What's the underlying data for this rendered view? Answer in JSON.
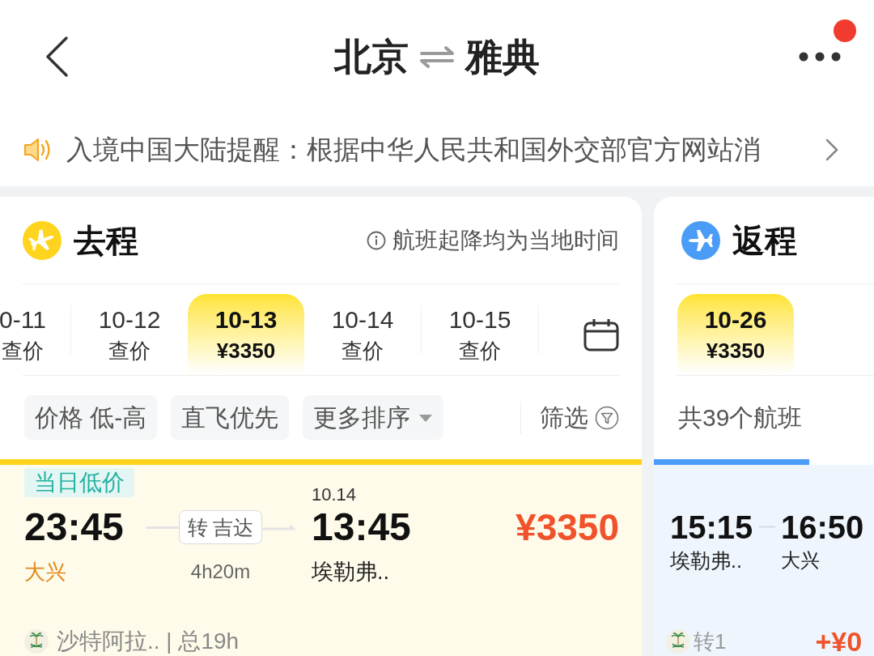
{
  "header": {
    "origin": "北京",
    "destination": "雅典",
    "has_notification": true
  },
  "notice": {
    "text": "入境中国大陆提醒：根据中华人民共和国外交部官方网站消"
  },
  "legs": [
    {
      "kind": "outbound",
      "color": "#ffd41e",
      "title": "去程",
      "note": "航班起降均为当地时间",
      "dates": [
        {
          "date": "0-11",
          "price": "查价",
          "selected": false
        },
        {
          "date": "10-12",
          "price": "查价",
          "selected": false
        },
        {
          "date": "10-13",
          "price": "¥3350",
          "selected": true
        },
        {
          "date": "10-14",
          "price": "查价",
          "selected": false
        },
        {
          "date": "10-15",
          "price": "查价",
          "selected": false
        }
      ],
      "sort_options": [
        {
          "label": "价格 低-高",
          "kind": "chip"
        },
        {
          "label": "直飞优先",
          "kind": "chip"
        },
        {
          "label": "更多排序",
          "kind": "dropdown"
        }
      ],
      "filter": "筛选",
      "flights": [
        {
          "tag": "当日低价",
          "depart_time": "23:45",
          "depart_airport": "大兴",
          "stop": "转 吉达",
          "duration": "4h20m",
          "arrive_date": "10.14",
          "arrive_time": "13:45",
          "arrive_airport": "埃勒弗..",
          "price": "¥3350",
          "airline": "沙特阿拉.. | 总19h"
        }
      ]
    },
    {
      "kind": "return",
      "color": "#4a9cf6",
      "title": "返程",
      "dates": [
        {
          "date": "10-26",
          "price": "¥3350",
          "selected": true
        }
      ],
      "count": "共39个航班",
      "flights": [
        {
          "depart_time": "15:15",
          "depart_airport": "埃勒弗..",
          "arrive_time": "16:50",
          "arrive_airport": "大兴",
          "stop": "转1",
          "price": "+¥0"
        }
      ]
    }
  ]
}
